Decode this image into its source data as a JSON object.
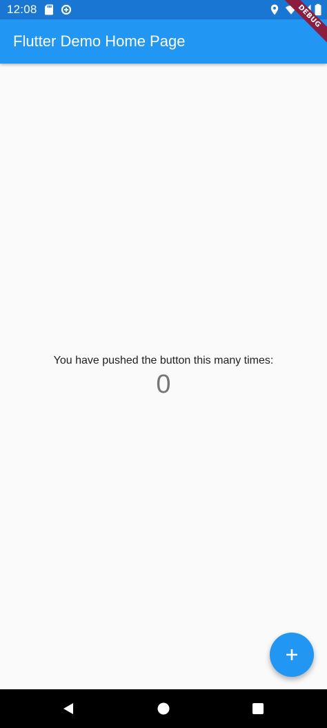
{
  "status_bar": {
    "time": "12:08",
    "left_icons": [
      "sd-card-icon",
      "data-saver-icon"
    ],
    "right_icons": [
      "location-icon",
      "wifi-icon",
      "signal-icon",
      "battery-icon"
    ],
    "color": "#1976d2"
  },
  "debug_banner": {
    "label": "DEBUG",
    "color": "#8b1e3f"
  },
  "app_bar": {
    "title": "Flutter Demo Home Page",
    "color": "#2196f3"
  },
  "main": {
    "message": "You have pushed the button this many times:",
    "counter": "0"
  },
  "fab": {
    "icon": "plus-icon",
    "color": "#2196f3"
  },
  "nav_bar": {
    "buttons": [
      "back-icon",
      "home-icon",
      "recents-icon"
    ]
  }
}
